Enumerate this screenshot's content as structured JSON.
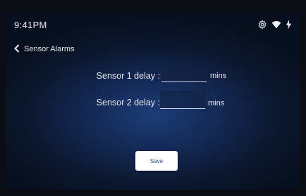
{
  "status_bar": {
    "time": "9:41PM",
    "icons": [
      "gear-icon",
      "wifi-icon",
      "lightning-icon"
    ]
  },
  "nav": {
    "back_icon": "chevron-left-icon",
    "title": "Sensor Alarms"
  },
  "form": {
    "sensor1": {
      "label": "Sensor 1 delay :",
      "value": "",
      "unit": "mins"
    },
    "sensor2": {
      "label": "Sensor 2 delay :",
      "value": "",
      "unit": "mins"
    }
  },
  "actions": {
    "save_label": "Save"
  },
  "colors": {
    "bezel": "#0b0d12",
    "screen_center": "#1d3c78",
    "screen_edge": "#08101f",
    "text": "#e6e8ee",
    "save_text": "#2c4a9a"
  }
}
